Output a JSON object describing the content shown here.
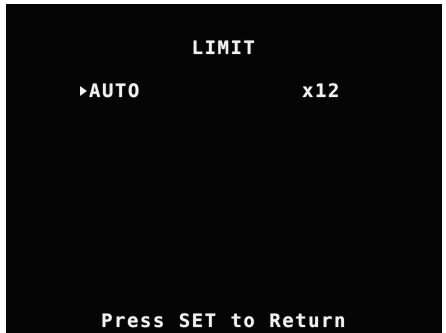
{
  "menu": {
    "title": "LIMIT",
    "items": [
      {
        "label": "AUTO",
        "value": "x12",
        "selected": true
      }
    ]
  },
  "footer": {
    "hint": "Press SET to Return"
  },
  "colors": {
    "background": "#050505",
    "text": "#f2f2f2",
    "border": "#ffffff"
  },
  "icons": {
    "cursor": "triangle-right-icon"
  }
}
